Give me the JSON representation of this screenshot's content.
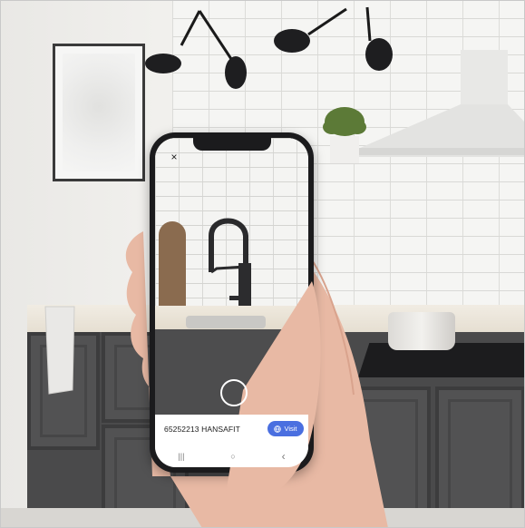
{
  "app": {
    "close_icon_glyph": "×",
    "capture_icon": "circle-outline-icon"
  },
  "result_card": {
    "product_text": "65252213 HANSAFIT",
    "visit_label": "Visit",
    "visit_icon": "globe-icon",
    "accent_color": "#4a6fe0"
  },
  "nav_bar": {
    "recents_glyph": "|||",
    "home_glyph": "○",
    "back_glyph": "‹"
  }
}
